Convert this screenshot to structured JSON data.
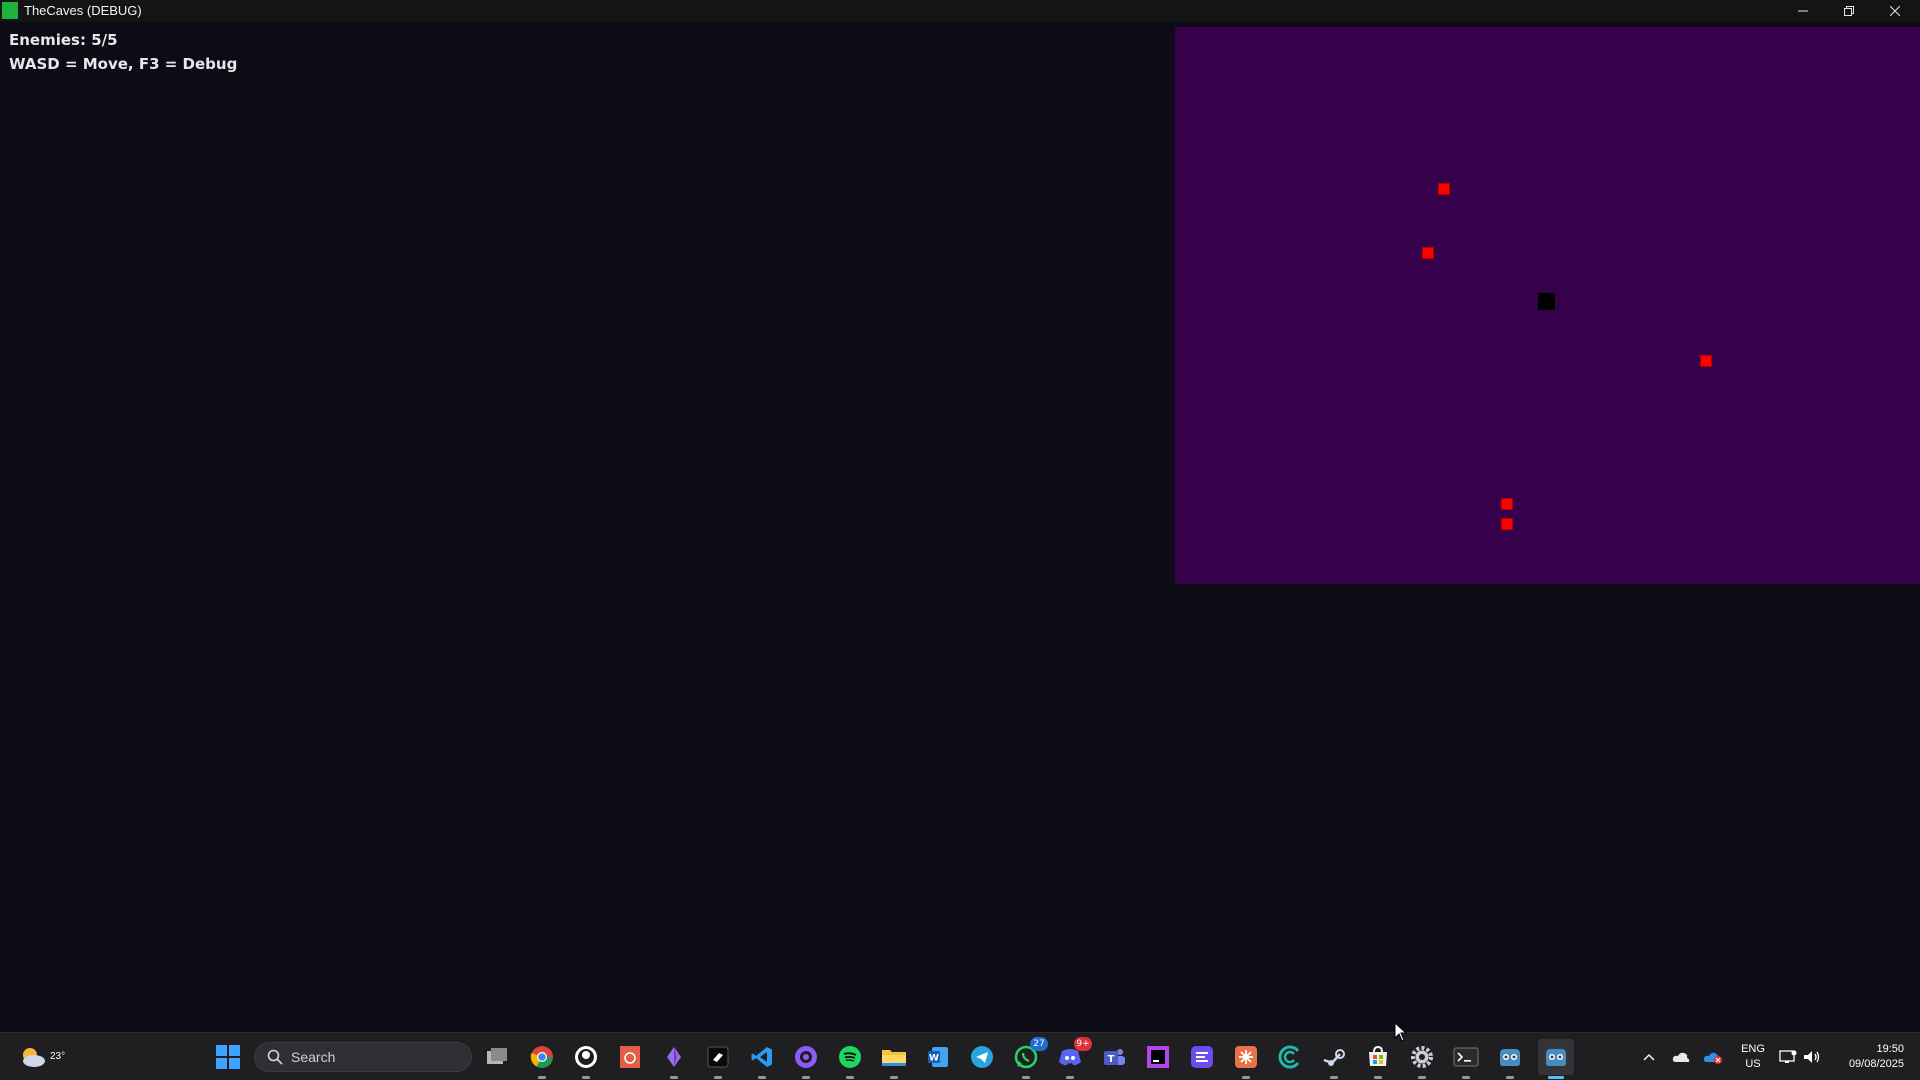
{
  "window": {
    "title": "TheCaves (DEBUG)"
  },
  "hud": {
    "enemies": "Enemies: 5/5",
    "controls": "WASD = Move, F3 = Debug"
  },
  "debug_view": {
    "background_color": "#37004a",
    "enemy_color": "#ff0000",
    "player_color": "#000000",
    "enemy_count": 5
  },
  "taskbar": {
    "weather": {
      "temperature": "23°"
    },
    "search": {
      "label": "Search"
    },
    "apps": [
      {
        "icon": "task-view-icon",
        "open": false
      },
      {
        "icon": "chrome-icon",
        "open": true
      },
      {
        "icon": "github-desktop-icon",
        "open": true
      },
      {
        "icon": "pdf-reader-icon",
        "open": false
      },
      {
        "icon": "visual-studio-icon",
        "open": true
      },
      {
        "icon": "terminal-app-icon",
        "open": true
      },
      {
        "icon": "vscode-icon",
        "open": true
      },
      {
        "icon": "github-icon",
        "open": true
      },
      {
        "icon": "spotify-icon",
        "open": true
      },
      {
        "icon": "file-explorer-icon",
        "open": true
      },
      {
        "icon": "word-icon",
        "open": false
      },
      {
        "icon": "telegram-icon",
        "open": false
      },
      {
        "icon": "whatsapp-icon",
        "open": true,
        "badge": "27"
      },
      {
        "icon": "discord-icon",
        "open": true,
        "badge": "9+"
      },
      {
        "icon": "teams-icon",
        "open": false
      },
      {
        "icon": "phpstorm-icon",
        "open": false
      },
      {
        "icon": "notes-app-icon",
        "open": false
      },
      {
        "icon": "claude-icon",
        "open": true
      },
      {
        "icon": "browser-icon",
        "open": false
      },
      {
        "icon": "steam-icon",
        "open": true
      },
      {
        "icon": "microsoft-store-icon",
        "open": true
      },
      {
        "icon": "settings-icon",
        "open": true
      },
      {
        "icon": "terminal-icon",
        "open": true
      },
      {
        "icon": "godot-icon",
        "open": true
      },
      {
        "icon": "godot-game-icon",
        "open": true,
        "active": true
      }
    ],
    "tray": {
      "language_line1": "ENG",
      "language_line2": "US",
      "time": "19:50",
      "date": "09/08/2025"
    }
  }
}
